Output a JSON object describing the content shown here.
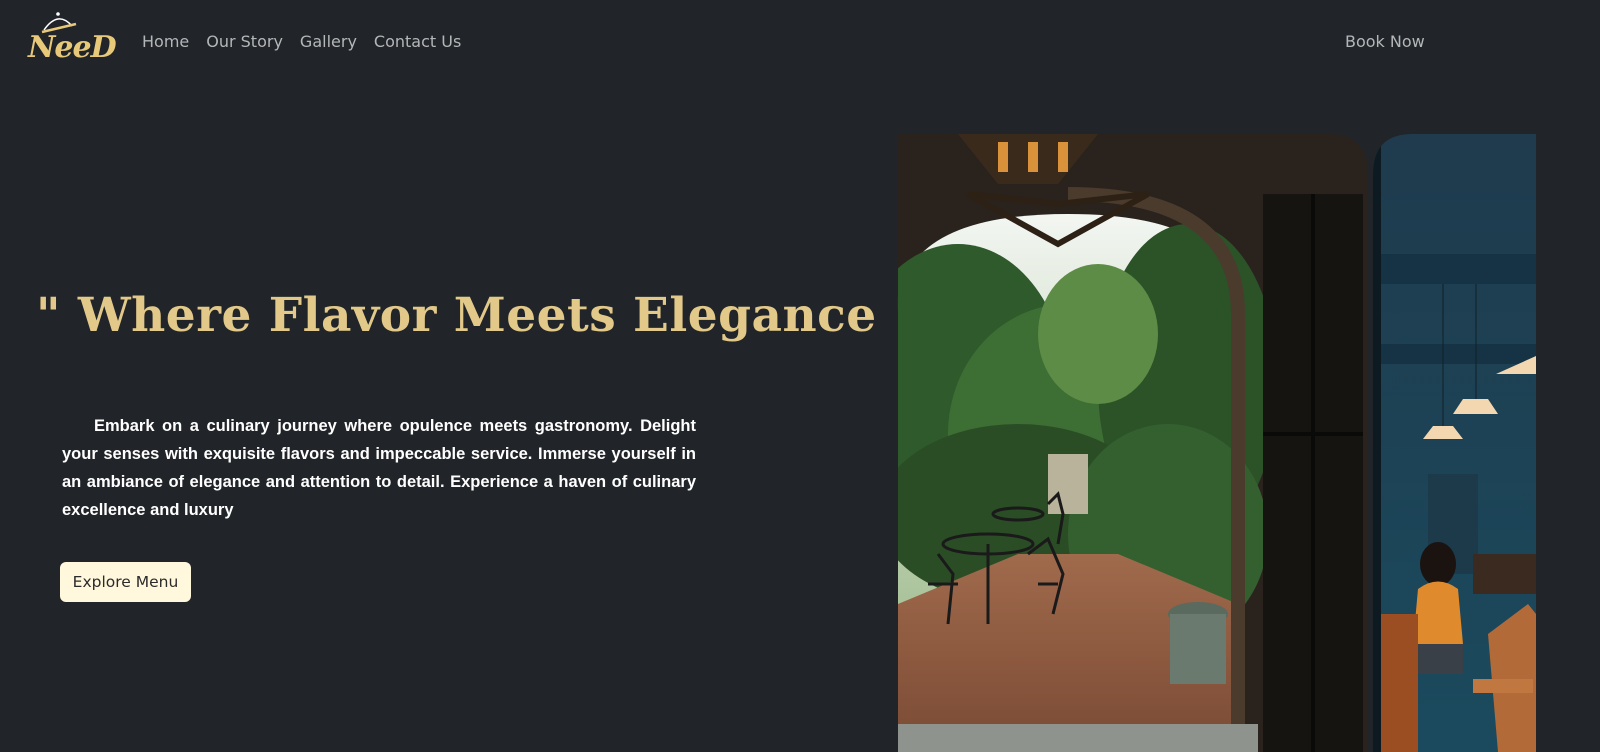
{
  "brand": {
    "logo_text": "NeeD",
    "logo_icon": "cloche-icon"
  },
  "nav": {
    "links": [
      {
        "label": "Home"
      },
      {
        "label": "Our Story"
      },
      {
        "label": "Gallery"
      },
      {
        "label": "Contact Us"
      }
    ],
    "cta_label": "Book Now"
  },
  "hero": {
    "headline": "\" Where Flavor Meets Elegance \"",
    "description": "Embark on a culinary journey where opulence meets gastronomy. Delight your senses with exquisite flavors and impeccable service. Immerse yourself in an ambiance of elegance and attention to detail. Experience a haven of culinary excellence and luxury",
    "button_label": "Explore Menu",
    "image": "restaurant-photo"
  },
  "colors": {
    "background": "#212529",
    "accent": "#e2c98a",
    "button_bg": "#fff8dc",
    "nav_text": "#b4b6b8"
  }
}
